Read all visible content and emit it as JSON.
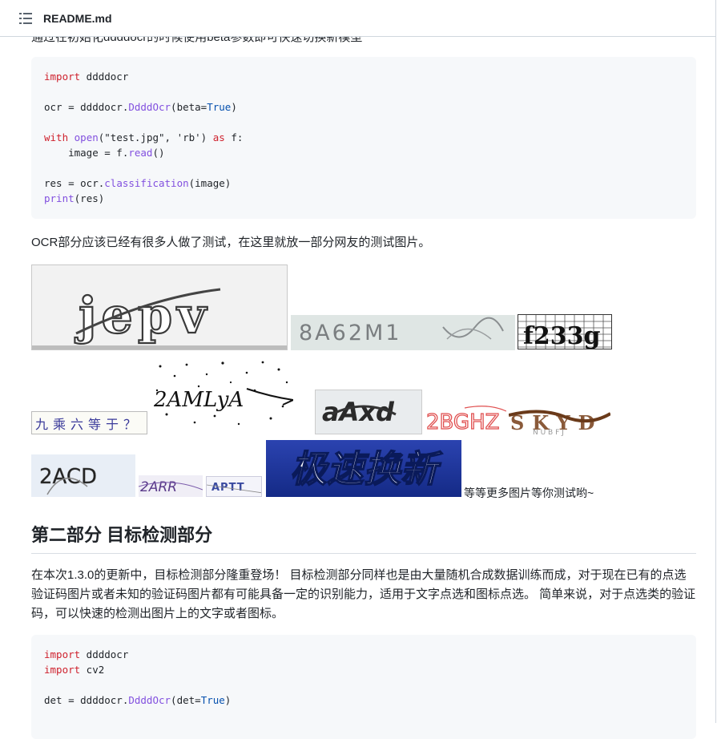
{
  "header": {
    "file_name": "README.md",
    "menu_icon": "list-unordered-icon"
  },
  "cut_text": "通过在初始化ddddocr的时候使用beta参数即可快速切换新模型",
  "code1": {
    "lines": [
      {
        "parts": [
          {
            "t": "import",
            "c": "kw"
          },
          {
            "t": " ddddocr",
            "c": ""
          }
        ]
      },
      {
        "parts": []
      },
      {
        "parts": [
          {
            "t": "ocr = ddddocr.",
            "c": ""
          },
          {
            "t": "DdddOcr",
            "c": "fn"
          },
          {
            "t": "(beta=",
            "c": ""
          },
          {
            "t": "True",
            "c": "bo"
          },
          {
            "t": ")",
            "c": ""
          }
        ]
      },
      {
        "parts": []
      },
      {
        "parts": [
          {
            "t": "with",
            "c": "kw"
          },
          {
            "t": " ",
            "c": ""
          },
          {
            "t": "open",
            "c": "fn"
          },
          {
            "t": "(\"test.jpg\", 'rb') ",
            "c": ""
          },
          {
            "t": "as",
            "c": "kw"
          },
          {
            "t": " f:",
            "c": ""
          }
        ]
      },
      {
        "parts": [
          {
            "t": "    image = f.",
            "c": ""
          },
          {
            "t": "read",
            "c": "fn"
          },
          {
            "t": "()",
            "c": ""
          }
        ]
      },
      {
        "parts": []
      },
      {
        "parts": [
          {
            "t": "res = ocr.",
            "c": ""
          },
          {
            "t": "classification",
            "c": "fn"
          },
          {
            "t": "(image)",
            "c": ""
          }
        ]
      },
      {
        "parts": [
          {
            "t": "print",
            "c": "fn"
          },
          {
            "t": "(res)",
            "c": ""
          }
        ]
      }
    ]
  },
  "ocr_intro": "OCR部分应该已经有很多人做了测试，在这里就放一部分网友的测试图片。",
  "captchas": {
    "jepv": "jepv",
    "c2": "8A62M1",
    "c3": "f233g",
    "c4": "九乘六等于？",
    "c5": "2AMLyA",
    "c6": "aAxd",
    "c7": "2BGHZ",
    "c8": "SKYD",
    "c9": "2ACD",
    "c10": "2ARR",
    "c11": "APTT",
    "c12": "极速换新"
  },
  "more_text": "等等更多图片等你测试哟~",
  "section2": {
    "title": "第二部分 目标检测部分",
    "para": "在本次1.3.0的更新中，目标检测部分隆重登场！ 目标检测部分同样也是由大量随机合成数据训练而成，对于现在已有的点选验证码图片或者未知的验证码图片都有可能具备一定的识别能力，适用于文字点选和图标点选。 简单来说，对于点选类的验证码，可以快速的检测出图片上的文字或者图标。"
  },
  "code2": {
    "lines": [
      {
        "parts": [
          {
            "t": "import",
            "c": "kw"
          },
          {
            "t": " ddddocr",
            "c": ""
          }
        ]
      },
      {
        "parts": [
          {
            "t": "import",
            "c": "kw"
          },
          {
            "t": " cv2",
            "c": ""
          }
        ]
      },
      {
        "parts": []
      },
      {
        "parts": [
          {
            "t": "det = ddddocr.",
            "c": ""
          },
          {
            "t": "DdddOcr",
            "c": "fn"
          },
          {
            "t": "(det=",
            "c": ""
          },
          {
            "t": "True",
            "c": "bo"
          },
          {
            "t": ")",
            "c": ""
          }
        ]
      }
    ]
  }
}
